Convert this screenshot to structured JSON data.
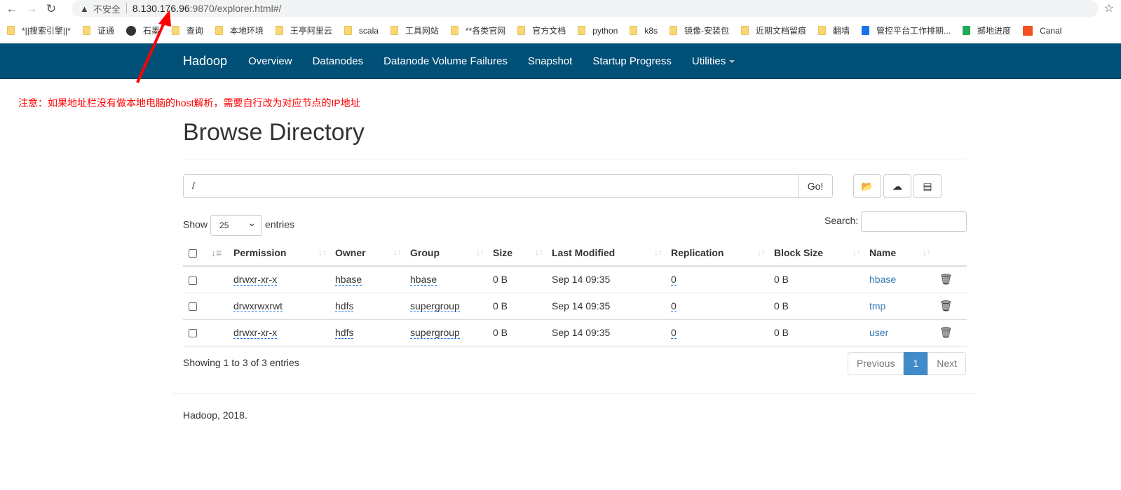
{
  "browser": {
    "insecure": "不安全",
    "url_host": "8.130.176.96",
    "url_path": ":9870/explorer.html#/",
    "bookmarks": [
      "*||搜索引擎||*",
      "证通",
      "石墨",
      "查询",
      "本地环境",
      "王亭阿里云",
      "scala",
      "工具网站",
      "**各类官网",
      "官方文档",
      "python",
      "k8s",
      "镜像-安装包",
      "近期文档留痕",
      "翻墙",
      "管控平台工作排期...",
      "撼地进度",
      "Canal"
    ]
  },
  "navbar": {
    "brand": "Hadoop",
    "items": [
      "Overview",
      "Datanodes",
      "Datanode Volume Failures",
      "Snapshot",
      "Startup Progress",
      "Utilities"
    ]
  },
  "annotation": "注意：如果地址栏没有做本地电脑的host解析，需要自行改为对应节点的IP地址",
  "page": {
    "title": "Browse Directory",
    "path": "/",
    "go": "Go!",
    "show": "Show",
    "entries_value": "25",
    "entries": "entries",
    "search": "Search:"
  },
  "table": {
    "headers": [
      "Permission",
      "Owner",
      "Group",
      "Size",
      "Last Modified",
      "Replication",
      "Block Size",
      "Name"
    ],
    "rows": [
      [
        "drwxr-xr-x",
        "hbase",
        "hbase",
        "0 B",
        "Sep 14 09:35",
        "0",
        "0 B",
        "hbase"
      ],
      [
        "drwxrwxrwt",
        "hdfs",
        "supergroup",
        "0 B",
        "Sep 14 09:35",
        "0",
        "0 B",
        "tmp"
      ],
      [
        "drwxr-xr-x",
        "hdfs",
        "supergroup",
        "0 B",
        "Sep 14 09:35",
        "0",
        "0 B",
        "user"
      ]
    ]
  },
  "footer_info": "Showing 1 to 3 of 3 entries",
  "pagination": {
    "prev": "Previous",
    "page": "1",
    "next": "Next"
  },
  "footer": "Hadoop, 2018.",
  "colors": {
    "navbar": "#005078",
    "annotation": "#ff0000",
    "link": "#337ab7",
    "active_page": "#428bca"
  }
}
